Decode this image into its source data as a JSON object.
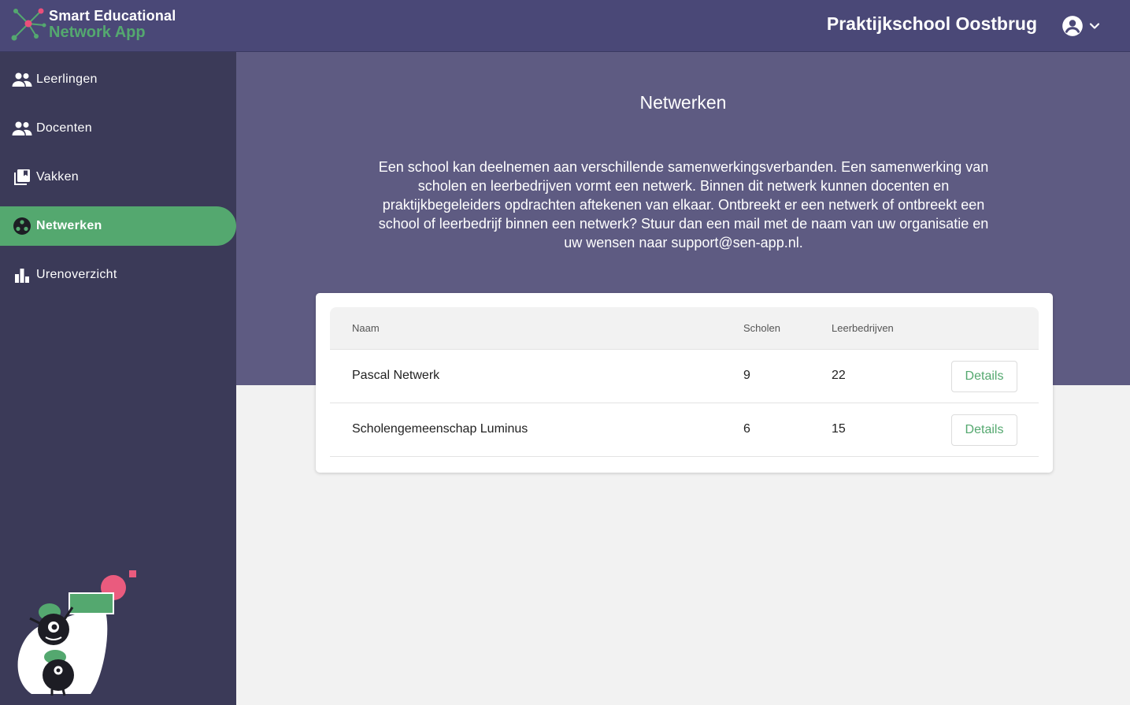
{
  "header": {
    "logo_line1": "Smart Educational",
    "logo_line2": "Network App",
    "school_name": "Praktijkschool Oostbrug",
    "account_icon": "account-circle-icon",
    "dropdown_icon": "chevron-down-icon"
  },
  "sidebar": {
    "items": [
      {
        "label": "Leerlingen",
        "icon": "people-icon",
        "active": false
      },
      {
        "label": "Docenten",
        "icon": "people-icon",
        "active": false
      },
      {
        "label": "Vakken",
        "icon": "library-books-icon",
        "active": false
      },
      {
        "label": "Netwerken",
        "icon": "network-icon",
        "active": true
      },
      {
        "label": "Urenoverzicht",
        "icon": "bar-chart-icon",
        "active": false
      }
    ]
  },
  "main": {
    "title": "Netwerken",
    "intro": "Een school kan deelnemen aan verschillende samenwerkingsverbanden. Een samenwerking van scholen en leerbedrijven vormt een netwerk. Binnen dit netwerk kunnen docenten en praktijkbegeleiders opdrachten aftekenen van elkaar. Ontbreekt er een netwerk of ontbreekt een school of leerbedrijf binnen een netwerk? Stuur dan een mail met de naam van uw organisatie en uw wensen naar support@sen-app.nl.",
    "table": {
      "columns": [
        "Naam",
        "Scholen",
        "Leerbedrijven"
      ],
      "rows": [
        {
          "naam": "Pascal Netwerk",
          "scholen": "9",
          "leerbedrijven": "22",
          "action": "Details"
        },
        {
          "naam": "Scholengemeenschap Luminus",
          "scholen": "6",
          "leerbedrijven": "15",
          "action": "Details"
        }
      ]
    }
  },
  "colors": {
    "header_bg": "#4a4877",
    "sidebar_bg": "#3b3a58",
    "hero_bg": "#5e5b82",
    "accent_green": "#54a86f",
    "page_bg": "#f2f2f2"
  }
}
